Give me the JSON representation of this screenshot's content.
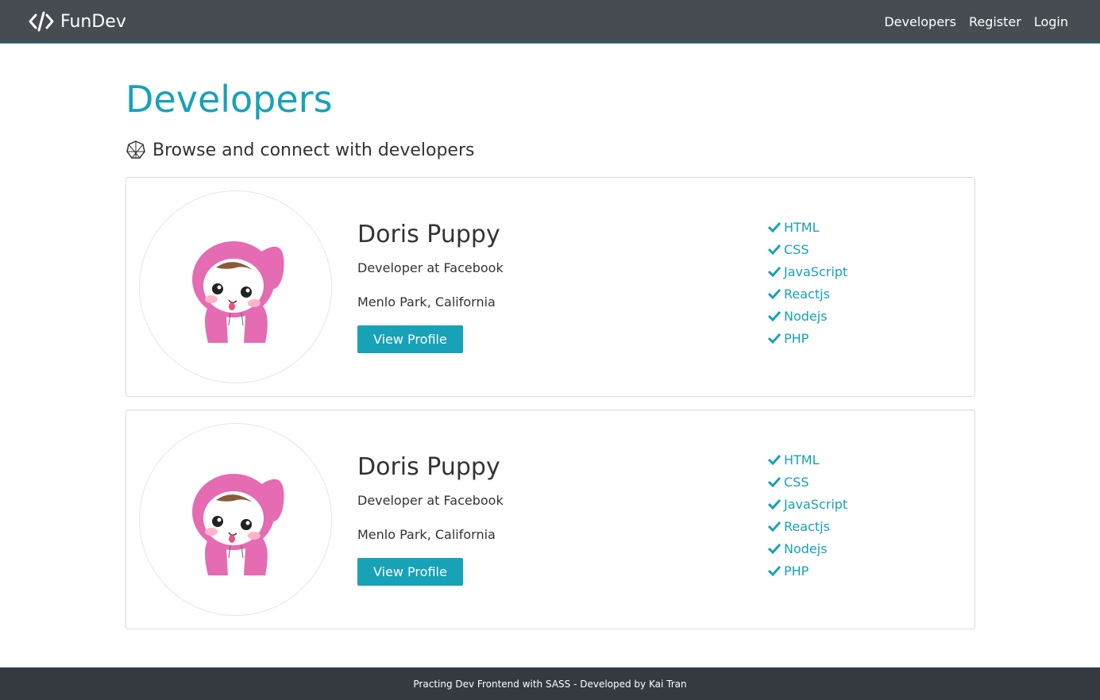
{
  "navbar": {
    "brand": "FunDev",
    "brand_icon": "code-icon",
    "links": [
      "Developers",
      "Register",
      "Login"
    ]
  },
  "main": {
    "title": "Developers",
    "lead_icon": "connect-icon",
    "lead": "Browse and connect with developers"
  },
  "profiles": [
    {
      "name": "Doris Puppy",
      "job": "Developer at Facebook",
      "location": "Menlo Park, California",
      "button": "View Profile",
      "skills": [
        "HTML",
        "CSS",
        "JavaScript",
        "Reactjs",
        "Nodejs",
        "PHP"
      ]
    },
    {
      "name": "Doris Puppy",
      "job": "Developer at Facebook",
      "location": "Menlo Park, California",
      "button": "View Profile",
      "skills": [
        "HTML",
        "CSS",
        "JavaScript",
        "Reactjs",
        "Nodejs",
        "PHP"
      ]
    }
  ],
  "footer": {
    "text": "Practing Dev Frontend with SASS - Developed by Kai Tran"
  },
  "colors": {
    "accent": "#17a2b8",
    "navbar": "#474c52",
    "footer": "#343a40"
  }
}
